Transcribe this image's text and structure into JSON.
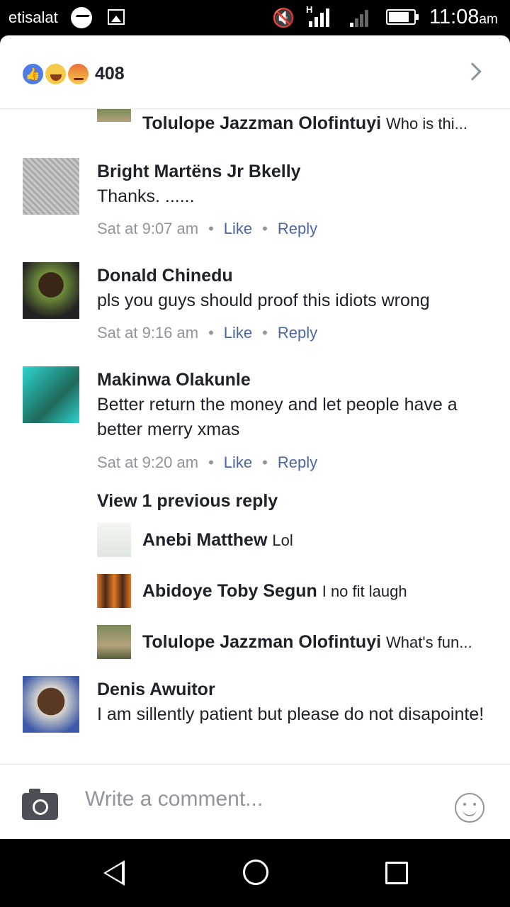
{
  "status_bar": {
    "carrier": "etisalat",
    "network_type": "H",
    "time": "11:08",
    "ampm": "am"
  },
  "reactions": {
    "count": "408",
    "types": [
      "like-icon",
      "haha-icon",
      "angry-icon"
    ]
  },
  "comments": [
    {
      "reply_top": {
        "name": "Tolulope Jazzman Olofintuyi",
        "text": "Who is thi..."
      }
    },
    {
      "name": "Bright Martëns Jr Bkelly",
      "text": "Thanks. ......",
      "time": "Sat at 9:07 am",
      "like": "Like",
      "reply": "Reply"
    },
    {
      "name": "Donald Chinedu",
      "text": "pls you guys should proof this idiots wrong",
      "time": "Sat at 9:16 am",
      "like": "Like",
      "reply": "Reply"
    },
    {
      "name": "Makinwa Olakunle",
      "text": "Better return the money and let people have a better merry xmas",
      "time": "Sat at 9:20 am",
      "like": "Like",
      "reply": "Reply",
      "view_previous": "View 1 previous reply",
      "replies": [
        {
          "name": "Anebi Matthew",
          "text": "Lol"
        },
        {
          "name": "Abidoye Toby Segun",
          "text": "I no  fit  laugh"
        },
        {
          "name": "Tolulope Jazzman Olofintuyi",
          "text": "What's fun..."
        }
      ]
    },
    {
      "name": "Denis Awuitor",
      "text": "I am sillently patient but please do not disapointe!"
    }
  ],
  "composer": {
    "placeholder": "Write a comment..."
  },
  "colors": {
    "link": "#4b67a1",
    "meta": "#90949c",
    "text": "#1d2129",
    "like_blue": "#4d7ce6"
  }
}
